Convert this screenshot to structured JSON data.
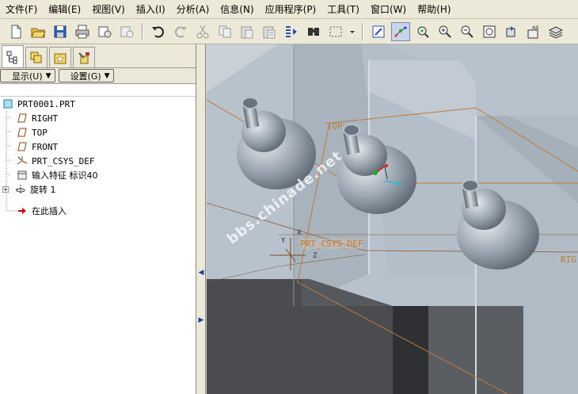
{
  "menu": [
    "文件(F)",
    "编辑(E)",
    "视图(V)",
    "插入(I)",
    "分析(A)",
    "信息(N)",
    "应用程序(P)",
    "工具(T)",
    "窗口(W)",
    "帮助(H)"
  ],
  "toolbar_icons": [
    "new-file-icon",
    "open-folder-icon",
    "save-icon",
    "print-icon",
    "send-mail-icon",
    "send-mail-alt-icon",
    "undo-icon",
    "redo-icon",
    "cut-icon",
    "copy-icon",
    "paste-icon",
    "paste-special-icon",
    "regenerate-icon",
    "find-icon",
    "select-box-icon",
    "dropdown-icon",
    "repaint-icon",
    "spin-center-icon",
    "orient-mode-icon",
    "zoom-in-icon",
    "zoom-out-icon",
    "refit-icon",
    "reorient-icon",
    "saved-views-icon",
    "layers-icon"
  ],
  "panel": {
    "tabs": [
      "model-tree-icon",
      "layer-tree-icon",
      "favorites-icon",
      "connections-icon"
    ],
    "show_label": "显示(U)",
    "settings_label": "设置(G)"
  },
  "tree": {
    "root": "PRT0001.PRT",
    "items": [
      {
        "label": "RIGHT",
        "icon": "datum-plane-icon"
      },
      {
        "label": "TOP",
        "icon": "datum-plane-icon"
      },
      {
        "label": "FRONT",
        "icon": "datum-plane-icon"
      },
      {
        "label": "PRT_CSYS_DEF",
        "icon": "csys-icon"
      },
      {
        "label": "输入特征 标识40",
        "icon": "import-feature-icon"
      },
      {
        "label": "旋转 1",
        "icon": "revolve-icon"
      },
      {
        "label": "在此插入",
        "icon": "insert-here-arrow-icon"
      }
    ]
  },
  "viewport": {
    "watermark": "bbs.chinade.net",
    "labels": {
      "top": "TOP",
      "csys": "PRT_CSYS_DEF",
      "right": "RIG",
      "x": "X",
      "y": "Y",
      "z": "Z"
    }
  },
  "colors": {
    "datum": "#c07a3a",
    "block_top": "#b8c2cc",
    "block_side": "#4a4c50",
    "gourd": "#9aa4ae"
  }
}
